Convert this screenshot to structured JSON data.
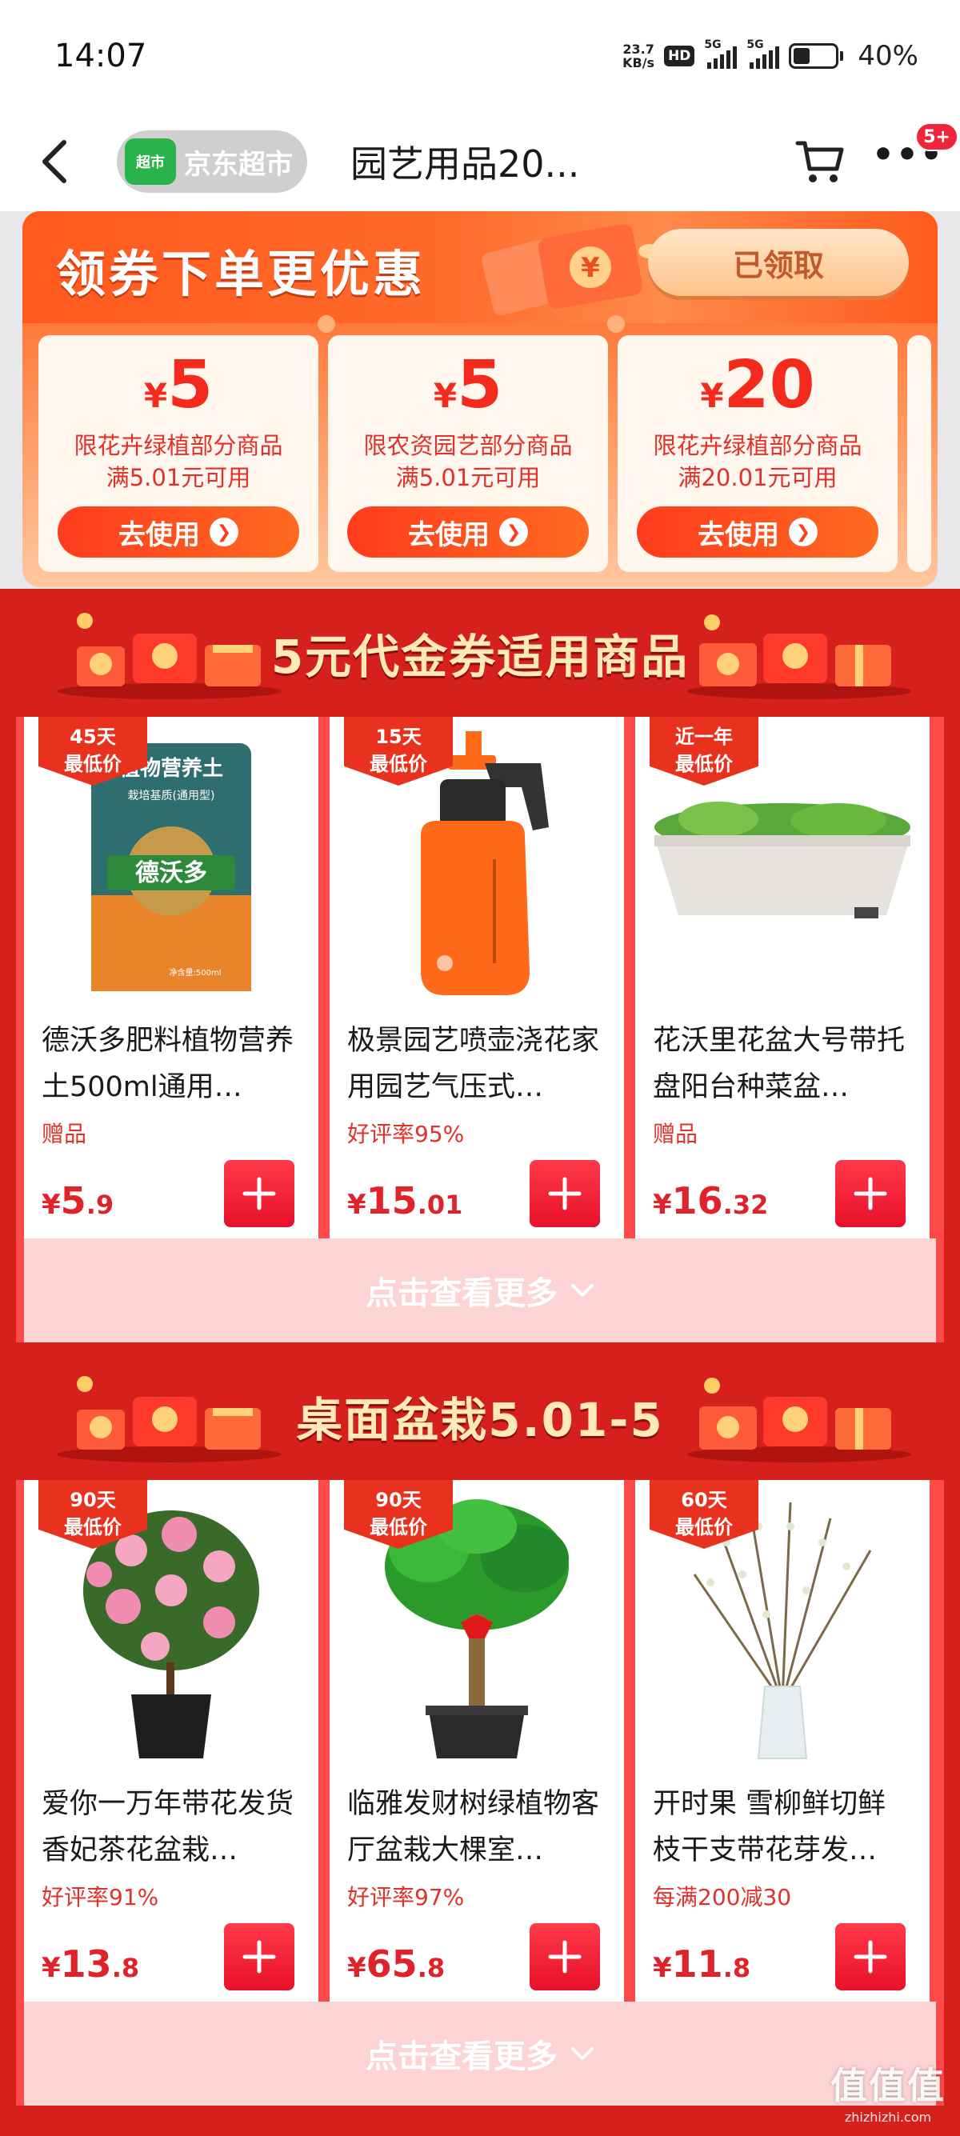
{
  "status_bar": {
    "time": "14:07",
    "net_speed_value": "23.7",
    "net_speed_unit": "KB/s",
    "hd_label": "HD",
    "signal1_label": "5G",
    "signal2_label": "5G",
    "battery_percent": 40,
    "battery_text": "40%"
  },
  "nav": {
    "back_icon": "chevron-left-icon",
    "store_tag": "超市",
    "store_name": "京东超市",
    "title": "园艺用品20...",
    "cart_icon": "cart-icon",
    "more_icon": "more-dots-icon",
    "more_badge": "5+"
  },
  "coupon_block": {
    "title": "领券下单更优惠",
    "claimed_label": "已领取",
    "coupons": [
      {
        "currency": "¥",
        "amount": "5",
        "cond_line1": "限花卉绿植部分商品",
        "cond_line2": "满5.01元可用",
        "button": "去使用"
      },
      {
        "currency": "¥",
        "amount": "5",
        "cond_line1": "限农资园艺部分商品",
        "cond_line2": "满5.01元可用",
        "button": "去使用"
      },
      {
        "currency": "¥",
        "amount": "20",
        "cond_line1": "限花卉绿植部分商品",
        "cond_line2": "满20.01元可用",
        "button": "去使用"
      }
    ]
  },
  "sections": [
    {
      "title": "5元代金券适用商品",
      "see_more": "点击查看更多",
      "products": [
        {
          "badge_line1": "45天",
          "badge_line2": "最低价",
          "name": "德沃多肥料植物营养土500ml通用…",
          "tag": "赠品",
          "currency": "¥",
          "price_int": "5",
          "price_dec": ".9"
        },
        {
          "badge_line1": "15天",
          "badge_line2": "最低价",
          "name": "极景园艺喷壶浇花家用园艺气压式…",
          "tag": "好评率95%",
          "currency": "¥",
          "price_int": "15",
          "price_dec": ".01"
        },
        {
          "badge_line1": "近一年",
          "badge_line2": "最低价",
          "name": "花沃里花盆大号带托盘阳台种菜盆…",
          "tag": "赠品",
          "currency": "¥",
          "price_int": "16",
          "price_dec": ".32"
        }
      ]
    },
    {
      "title": "桌面盆栽5.01-5",
      "see_more": "点击查看更多",
      "products": [
        {
          "badge_line1": "90天",
          "badge_line2": "最低价",
          "name": "爱你一万年带花发货香妃茶花盆栽…",
          "tag": "好评率91%",
          "currency": "¥",
          "price_int": "13",
          "price_dec": ".8"
        },
        {
          "badge_line1": "90天",
          "badge_line2": "最低价",
          "name": "临雅发财树绿植物客厅盆栽大棵室…",
          "tag": "好评率97%",
          "currency": "¥",
          "price_int": "65",
          "price_dec": ".8"
        },
        {
          "badge_line1": "60天",
          "badge_line2": "最低价",
          "name": "开时果 雪柳鲜切鲜枝干支带花芽发…",
          "tag": "每满200减30",
          "currency": "¥",
          "price_int": "11",
          "price_dec": ".8"
        }
      ]
    }
  ],
  "product1_pack": {
    "title": "植物营养土",
    "subtitle": "栽培基质(通用型)",
    "brand": "德沃多",
    "net": "净含量:500ml"
  },
  "watermark": {
    "big": "值值值",
    "small": "zhizhizhi.com"
  },
  "colors": {
    "accent_red": "#d6201c",
    "price_red": "#e0222a",
    "coupon_orange": "#ff5a1e"
  }
}
